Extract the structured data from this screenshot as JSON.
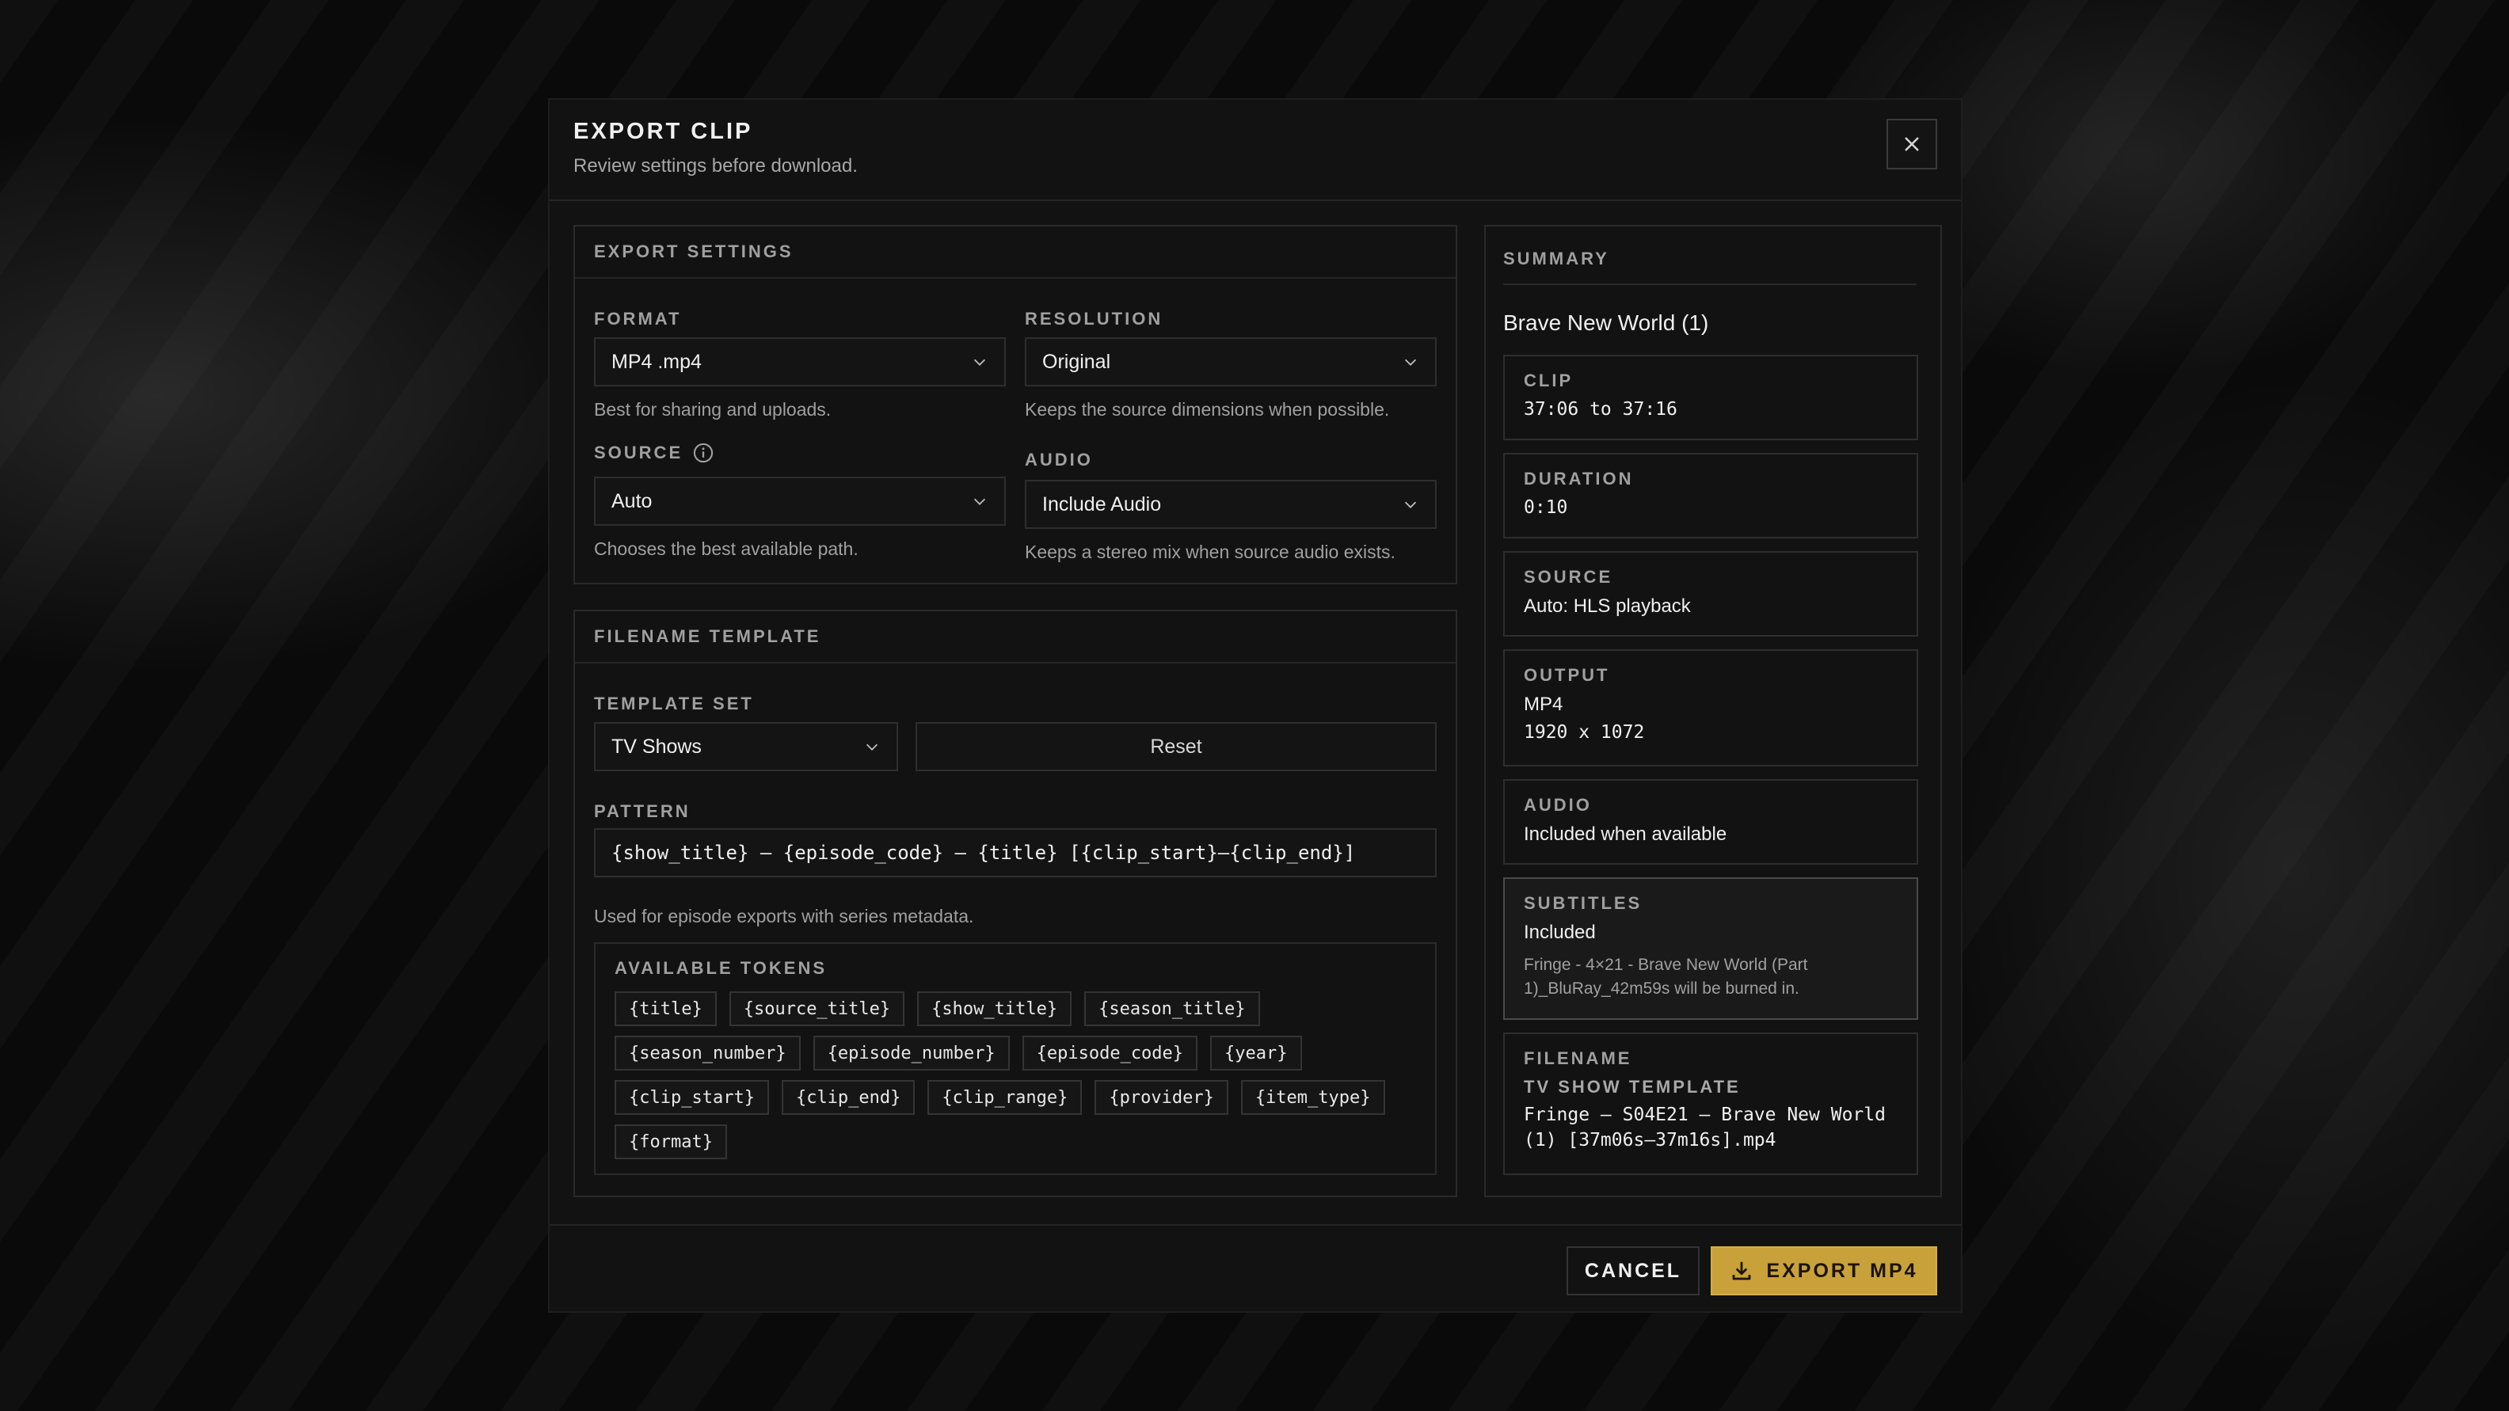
{
  "dialog": {
    "title": "EXPORT CLIP",
    "subtitle": "Review settings before download."
  },
  "export_settings": {
    "heading": "EXPORT SETTINGS",
    "format": {
      "label": "FORMAT",
      "value": "MP4 .mp4",
      "help": "Best for sharing and uploads."
    },
    "resolution": {
      "label": "RESOLUTION",
      "value": "Original",
      "help": "Keeps the source dimensions when possible."
    },
    "source": {
      "label": "SOURCE",
      "value": "Auto",
      "help": "Chooses the best available path."
    },
    "audio": {
      "label": "AUDIO",
      "value": "Include Audio",
      "help": "Keeps a stereo mix when source audio exists."
    }
  },
  "filename_template": {
    "heading": "FILENAME TEMPLATE",
    "template_set": {
      "label": "TEMPLATE SET",
      "value": "TV Shows"
    },
    "reset_label": "Reset",
    "pattern": {
      "label": "PATTERN",
      "value": "{show_title} – {episode_code} – {title} [{clip_start}–{clip_end}]",
      "help": "Used for episode exports with series metadata."
    },
    "tokens": {
      "label": "AVAILABLE TOKENS",
      "items": [
        "{title}",
        "{source_title}",
        "{show_title}",
        "{season_title}",
        "{season_number}",
        "{episode_number}",
        "{episode_code}",
        "{year}",
        "{clip_start}",
        "{clip_end}",
        "{clip_range}",
        "{provider}",
        "{item_type}",
        "{format}"
      ]
    }
  },
  "summary": {
    "heading": "SUMMARY",
    "title": "Brave New World (1)",
    "clip": {
      "label": "CLIP",
      "value": "37:06 to 37:16"
    },
    "duration": {
      "label": "DURATION",
      "value": "0:10"
    },
    "source": {
      "label": "SOURCE",
      "value": "Auto: HLS playback"
    },
    "output": {
      "label": "OUTPUT",
      "format": "MP4",
      "dimensions": "1920 x 1072"
    },
    "audio": {
      "label": "AUDIO",
      "value": "Included when available"
    },
    "subtitles": {
      "label": "SUBTITLES",
      "value": "Included",
      "note": "Fringe - 4×21 - Brave New World (Part 1)_BluRay_42m59s will be burned in."
    },
    "filename": {
      "label": "FILENAME",
      "sublabel": "TV SHOW TEMPLATE",
      "value": "Fringe – S04E21 – Brave New World (1) [37m06s–37m16s].mp4"
    }
  },
  "footer": {
    "cancel_label": "CANCEL",
    "export_label": "EXPORT MP4"
  },
  "colors": {
    "accent": "#c8a13a",
    "background": "#121212",
    "border": "#2a2a2a"
  },
  "icons": [
    "close-icon",
    "chevron-down-icon",
    "info-icon",
    "download-icon"
  ]
}
